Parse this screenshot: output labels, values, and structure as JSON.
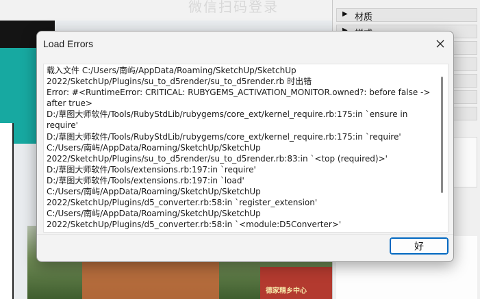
{
  "background": {
    "login_title": "微信扫码登录",
    "building_sign": "德家精乡中心"
  },
  "tray": {
    "materials_label": "材质",
    "styles_label": "样式",
    "collapsed_arrow": "▶"
  },
  "dialog": {
    "title": "Load Errors",
    "close_icon": "close-icon",
    "ok_label": "好",
    "lines": [
      "载入文件 C:/Users/南屿/AppData/Roaming/SketchUp/SketchUp",
      "2022/SketchUp/Plugins/su_to_d5render/su_to_d5render.rb 时出错",
      "Error: #<RuntimeError: CRITICAL: RUBYGEMS_ACTIVATION_MONITOR.owned?: before false ->",
      "after true>",
      "D:/草图大师软件/Tools/RubyStdLib/rubygems/core_ext/kernel_require.rb:175:in `ensure in",
      "require'",
      "D:/草图大师软件/Tools/RubyStdLib/rubygems/core_ext/kernel_require.rb:175:in `require'",
      "C:/Users/南屿/AppData/Roaming/SketchUp/SketchUp",
      "2022/SketchUp/Plugins/su_to_d5render/su_to_d5render.rb:83:in `<top (required)>'",
      "D:/草图大师软件/Tools/extensions.rb:197:in `require'",
      "D:/草图大师软件/Tools/extensions.rb:197:in `load'",
      "C:/Users/南屿/AppData/Roaming/SketchUp/SketchUp",
      "2022/SketchUp/Plugins/d5_converter.rb:58:in `register_extension'",
      "C:/Users/南屿/AppData/Roaming/SketchUp/SketchUp",
      "2022/SketchUp/Plugins/d5_converter.rb:58:in `<module:D5Converter>'"
    ]
  }
}
